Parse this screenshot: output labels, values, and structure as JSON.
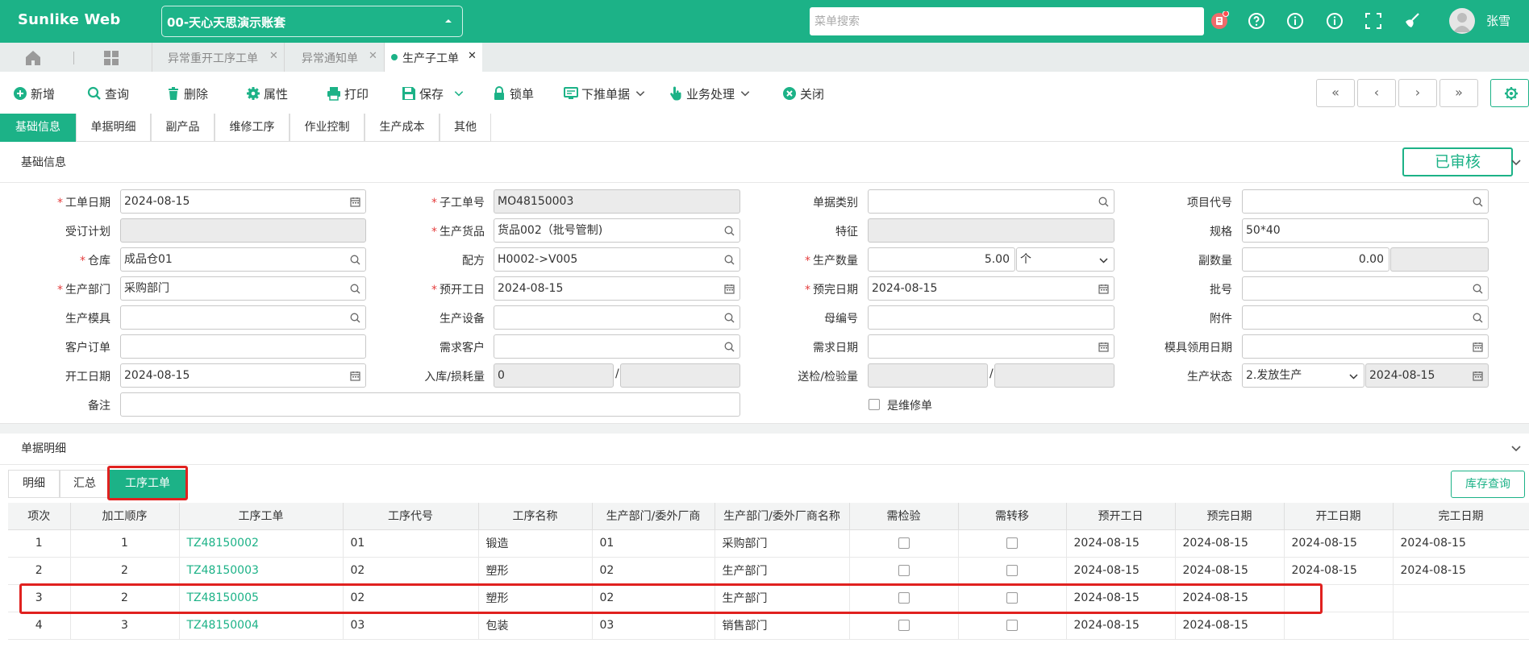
{
  "header": {
    "brand": "Sunlike Web",
    "account": "00-天心天思演示账套",
    "search_placeholder": "菜单搜索",
    "username": "张雪"
  },
  "tabs": [
    {
      "label": "异常重开工序工单"
    },
    {
      "label": "异常通知单"
    },
    {
      "label": "生产子工单"
    }
  ],
  "toolbar": {
    "new": "新增",
    "query": "查询",
    "delete": "删除",
    "attr": "属性",
    "print": "打印",
    "save": "保存",
    "lock": "锁单",
    "push": "下推单据",
    "business": "业务处理",
    "close": "关闭"
  },
  "section_tabs": [
    "基础信息",
    "单据明细",
    "副产品",
    "维修工序",
    "作业控制",
    "生产成本",
    "其他"
  ],
  "basic": {
    "title": "基础信息",
    "status": "已审核"
  },
  "form": {
    "work_date_label": "工单日期",
    "work_date": "2024-08-15",
    "sub_no_label": "子工单号",
    "sub_no": "MO48150003",
    "doc_type_label": "单据类别",
    "project_label": "项目代号",
    "order_plan_label": "受订计划",
    "product_label": "生产货品",
    "product": "货品002（批号管制)",
    "feature_label": "特征",
    "spec_label": "规格",
    "spec": "50*40",
    "warehouse_label": "仓库",
    "warehouse": "成品仓01",
    "recipe_label": "配方",
    "recipe": "H0002->V005",
    "qty_label": "生产数量",
    "qty": "5.00",
    "unit": "个",
    "sub_qty_label": "副数量",
    "sub_qty": "0.00",
    "dept_label": "生产部门",
    "dept": "采购部门",
    "plan_start_label": "预开工日",
    "plan_start": "2024-08-15",
    "plan_end_label": "预完日期",
    "plan_end": "2024-08-15",
    "batch_label": "批号",
    "mold_label": "生产模具",
    "equip_label": "生产设备",
    "parent_no_label": "母编号",
    "attach_label": "附件",
    "cust_order_label": "客户订单",
    "demand_cust_label": "需求客户",
    "demand_date_label": "需求日期",
    "mold_date_label": "模具领用日期",
    "start_date_label": "开工日期",
    "start_date": "2024-08-15",
    "loss_label": "入库/损耗量",
    "loss": "0",
    "inspect_label": "送检/检验量",
    "prod_status_label": "生产状态",
    "prod_status": "2.发放生产",
    "prod_status_date": "2024-08-15",
    "remark_label": "备注",
    "repair_label": "是维修单"
  },
  "detail": {
    "title": "单据明细",
    "subtabs": [
      "明细",
      "汇总",
      "工序工单"
    ],
    "stock_button": "库存查询",
    "columns": [
      "项次",
      "加工顺序",
      "工序工单",
      "工序代号",
      "工序名称",
      "生产部门/委外厂商",
      "生产部门/委外厂商名称",
      "需检验",
      "需转移",
      "预开工日",
      "预完日期",
      "开工日期",
      "完工日期"
    ],
    "rows": [
      {
        "idx": "1",
        "seq": "1",
        "order": "TZ48150002",
        "code": "01",
        "name": "锻造",
        "dept": "01",
        "dept_name": "采购部门",
        "plan_start": "2024-08-15",
        "plan_end": "2024-08-15",
        "start": "2024-08-15",
        "end": "2024-08-15"
      },
      {
        "idx": "2",
        "seq": "2",
        "order": "TZ48150003",
        "code": "02",
        "name": "塑形",
        "dept": "02",
        "dept_name": "生产部门",
        "plan_start": "2024-08-15",
        "plan_end": "2024-08-15",
        "start": "2024-08-15",
        "end": "2024-08-15"
      },
      {
        "idx": "3",
        "seq": "2",
        "order": "TZ48150005",
        "code": "02",
        "name": "塑形",
        "dept": "02",
        "dept_name": "生产部门",
        "plan_start": "2024-08-15",
        "plan_end": "2024-08-15",
        "start": "",
        "end": ""
      },
      {
        "idx": "4",
        "seq": "3",
        "order": "TZ48150004",
        "code": "03",
        "name": "包装",
        "dept": "03",
        "dept_name": "销售部门",
        "plan_start": "2024-08-15",
        "plan_end": "2024-08-15",
        "start": "",
        "end": ""
      }
    ]
  },
  "colors": {
    "accent": "#1cb287",
    "highlight": "#e0211f",
    "required": "#e53e3e"
  }
}
